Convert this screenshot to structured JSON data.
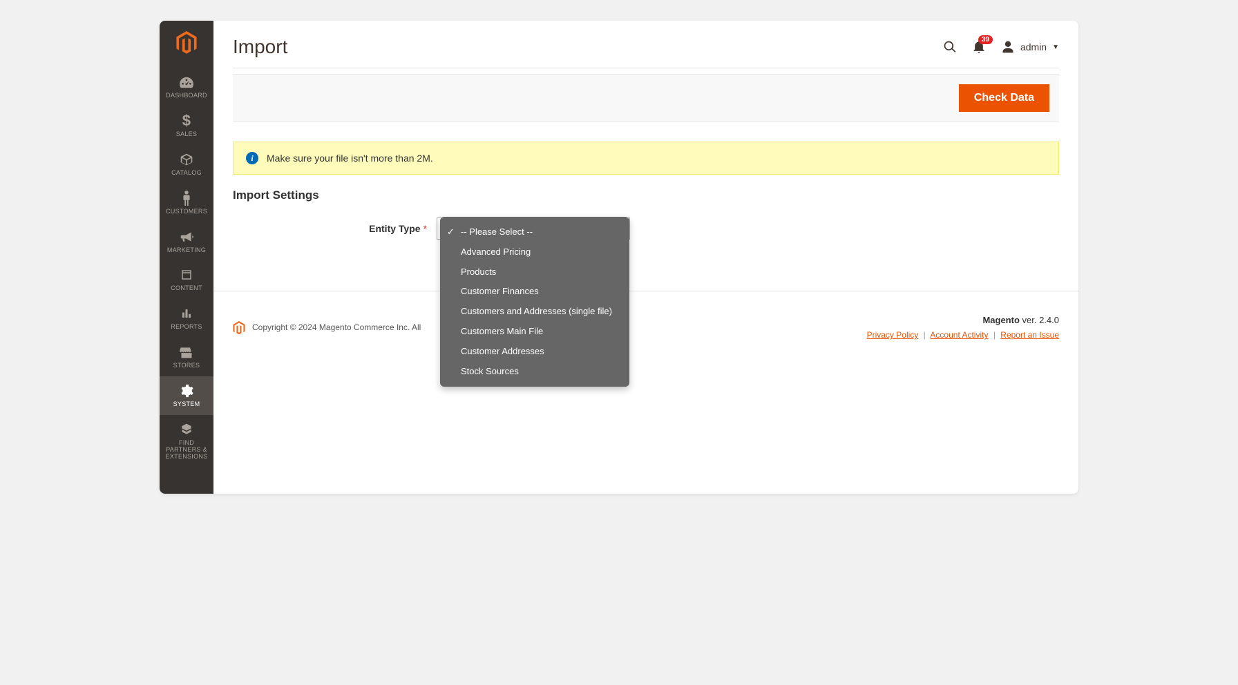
{
  "sidebar": {
    "items": [
      {
        "label": "DASHBOARD"
      },
      {
        "label": "SALES"
      },
      {
        "label": "CATALOG"
      },
      {
        "label": "CUSTOMERS"
      },
      {
        "label": "MARKETING"
      },
      {
        "label": "CONTENT"
      },
      {
        "label": "REPORTS"
      },
      {
        "label": "STORES"
      },
      {
        "label": "SYSTEM"
      },
      {
        "label": "FIND PARTNERS & EXTENSIONS"
      }
    ]
  },
  "header": {
    "title": "Import",
    "notification_count": "39",
    "admin_label": "admin"
  },
  "action_bar": {
    "check_data_label": "Check Data"
  },
  "message": {
    "text": "Make sure your file isn't more than 2M."
  },
  "import_settings": {
    "section_title": "Import Settings",
    "entity_type_label": "Entity Type",
    "dropdown_options": [
      "-- Please Select --",
      "Advanced Pricing",
      "Products",
      "Customer Finances",
      "Customers and Addresses (single file)",
      "Customers Main File",
      "Customer Addresses",
      "Stock Sources"
    ]
  },
  "footer": {
    "copyright": "Copyright © 2024 Magento Commerce Inc. All",
    "version_prefix": "Magento",
    "version_suffix": " ver. 2.4.0",
    "privacy": "Privacy Policy",
    "account": " Account Activity",
    "report": "Report an Issue"
  }
}
